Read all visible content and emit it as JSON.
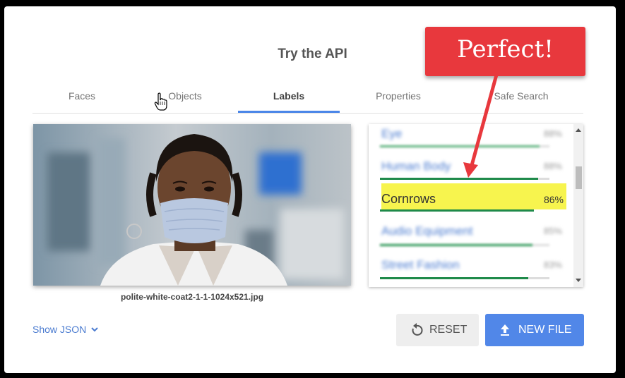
{
  "heading": "Try the API",
  "tabs": [
    {
      "label": "Faces"
    },
    {
      "label": "Objects"
    },
    {
      "label": "Labels"
    },
    {
      "label": "Properties"
    },
    {
      "label": "Safe Search"
    }
  ],
  "active_tab": "Labels",
  "image": {
    "filename": "polite-white-coat2-1-1-1024x521.jpg"
  },
  "labels": [
    {
      "label": "Eye",
      "percent": "88%",
      "score": 0.88,
      "blurred": true
    },
    {
      "label": "Human Body",
      "percent": "88%",
      "score": 0.88,
      "blurred": true
    },
    {
      "label": "Cornrows",
      "percent": "86%",
      "score": 0.86,
      "blurred": false
    },
    {
      "label": "Audio Equipment",
      "percent": "85%",
      "score": 0.85,
      "blurred": true
    },
    {
      "label": "Street Fashion",
      "percent": "83%",
      "score": 0.83,
      "blurred": true
    }
  ],
  "show_json": "Show JSON",
  "buttons": {
    "reset": "RESET",
    "new_file": "NEW FILE"
  },
  "callout": {
    "text": "Perfect!"
  },
  "colors": {
    "accent": "#4a86e8",
    "callout": "#e8383d",
    "highlight": "#f7f44e",
    "bar": "#1e8a4a"
  }
}
